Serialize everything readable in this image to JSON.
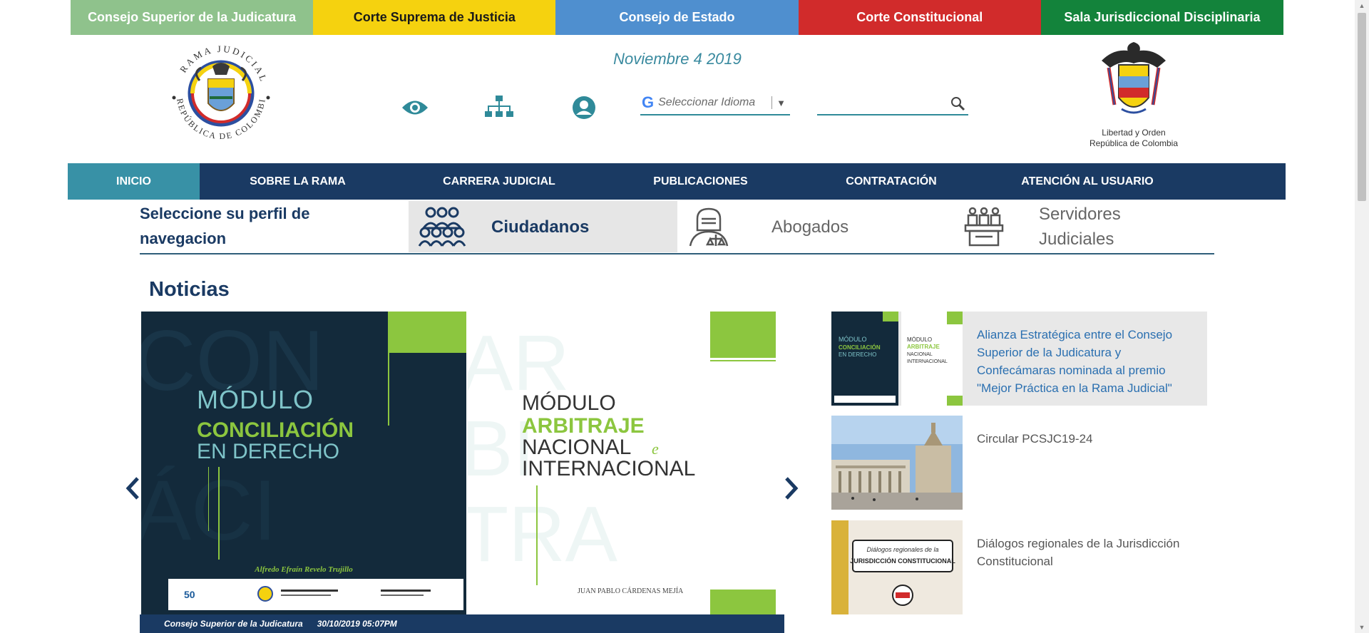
{
  "topbar": {
    "items": [
      {
        "label": "Consejo Superior de la Judicatura",
        "bg": "#8fc28c",
        "color": "#ffffff"
      },
      {
        "label": "Corte Suprema de Justicia",
        "bg": "#f5d20f",
        "color": "#1a1a1a"
      },
      {
        "label": "Consejo de Estado",
        "bg": "#4f8fcf",
        "color": "#ffffff"
      },
      {
        "label": "Corte Constitucional",
        "bg": "#d12b2b",
        "color": "#ffffff"
      },
      {
        "label": "Sala Jurisdiccional Disciplinaria",
        "bg": "#13833b",
        "color": "#ffffff"
      }
    ]
  },
  "header": {
    "logo_left_text": "RAMA JUDICIAL · REPÚBLICA DE COLOMBIA",
    "date": "Noviembre 4 2019",
    "icons": [
      "eye-icon",
      "sitemap-icon",
      "user-icon"
    ],
    "language": {
      "placeholder": "Seleccionar Idioma",
      "g_letter": "G"
    },
    "search": {
      "value": "",
      "placeholder": ""
    },
    "logo_right_caption_line1": "Libertad y Orden",
    "logo_right_caption_line2": "República de Colombia"
  },
  "nav": {
    "items": [
      {
        "label": "INICIO",
        "active": true
      },
      {
        "label": "SOBRE LA RAMA",
        "active": false
      },
      {
        "label": "CARRERA JUDICIAL",
        "active": false
      },
      {
        "label": "PUBLICACIONES",
        "active": false
      },
      {
        "label": "CONTRATACIÓN",
        "active": false
      },
      {
        "label": "ATENCIÓN AL USUARIO",
        "active": false
      }
    ]
  },
  "profile": {
    "title": "Seleccione su perfil de navegacion",
    "tabs": [
      {
        "label": "Ciudadanos",
        "selected": true
      },
      {
        "label": "Abogados",
        "selected": false
      },
      {
        "label": "Servidores Judiciales",
        "selected": false
      }
    ]
  },
  "news": {
    "heading": "Noticias",
    "slide_a": {
      "line1": "MÓDULO",
      "line2": "CONCILIACIÓN",
      "line3": "EN DERECHO",
      "author": "Alfredo Efraín Revelo Trujillo"
    },
    "slide_b": {
      "line1": "MÓDULO",
      "line2": "ARBITRAJE",
      "line3": "NACIONAL",
      "line3b": "e",
      "line4": "INTERNACIONAL",
      "author": "JUAN PABLO CÁRDENAS MEJÍA"
    },
    "caption": {
      "source": "Consejo Superior de la Judicatura",
      "datetime": "30/10/2019 05:07PM"
    },
    "side_items": [
      {
        "text": "Alianza Estratégica entre el Consejo Superior de la Judicatura y Confecámaras nominada al premio \"Mejor Práctica en la Rama Judicial\"",
        "active": true
      },
      {
        "text": "Circular PCSJC19-24",
        "active": false
      },
      {
        "text": "Diálogos regionales de la Jurisdicción Constitucional",
        "active": false
      }
    ],
    "dialogos_thumb_line1": "Diálogos regionales de la",
    "dialogos_thumb_line2": "JURISDICCIÓN CONSTITUCIONAL"
  },
  "colors": {
    "navy": "#1a3a63",
    "teal": "#3891a6",
    "accent_green": "#8cc63f"
  }
}
